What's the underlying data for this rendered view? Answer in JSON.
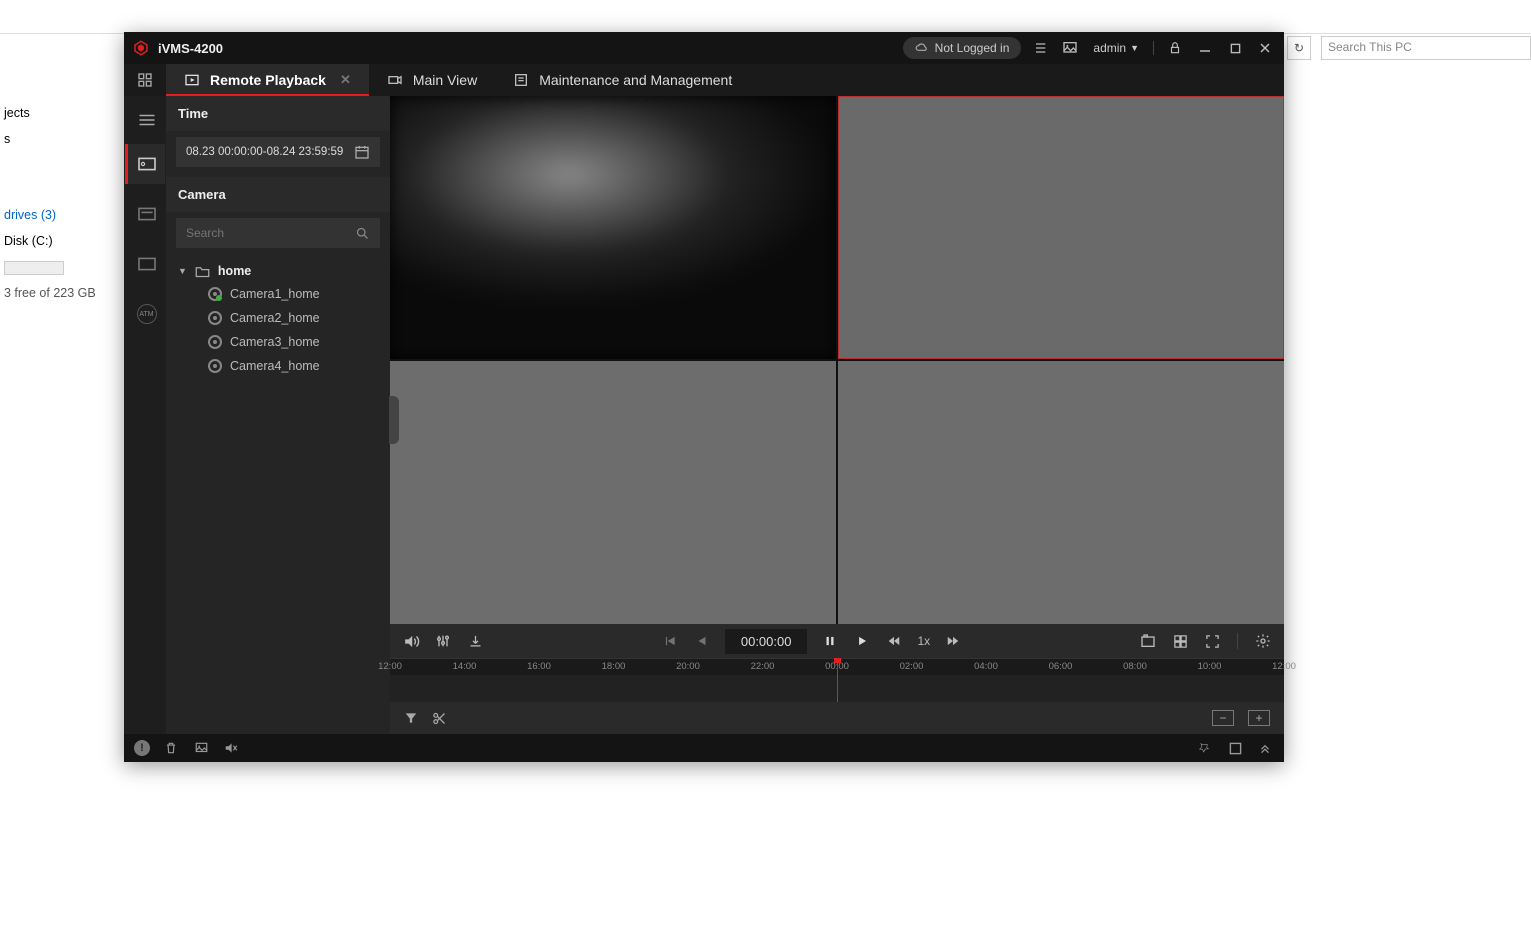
{
  "app": {
    "title": "iVMS-4200"
  },
  "titlebar": {
    "login_status": "Not Logged in",
    "user": "admin"
  },
  "tabs": {
    "remote_playback": "Remote Playback",
    "main_view": "Main View",
    "maintenance": "Maintenance and Management"
  },
  "sidebar": {
    "time_label": "Time",
    "date_range": "08.23 00:00:00-08.24 23:59:59",
    "camera_label": "Camera",
    "search_placeholder": "Search",
    "root_folder": "home",
    "cameras": [
      {
        "name": "Camera1_home",
        "recording": true
      },
      {
        "name": "Camera2_home",
        "recording": false
      },
      {
        "name": "Camera3_home",
        "recording": false
      },
      {
        "name": "Camera4_home",
        "recording": false
      }
    ]
  },
  "iconrail": {
    "atm": "ATM"
  },
  "playback": {
    "current_time": "00:00:00",
    "speed": "1x"
  },
  "timeline": {
    "ticks": [
      "12:00",
      "14:00",
      "16:00",
      "18:00",
      "20:00",
      "22:00",
      "00:00",
      "02:00",
      "04:00",
      "06:00",
      "08:00",
      "10:00",
      "12:00"
    ]
  },
  "explorer": {
    "search_placeholder": "Search This PC",
    "nav_objects": "jects",
    "nav_drives": "drives (3)",
    "disk_label": "Disk (C:)",
    "disk_free": "3 free of 223 GB"
  }
}
